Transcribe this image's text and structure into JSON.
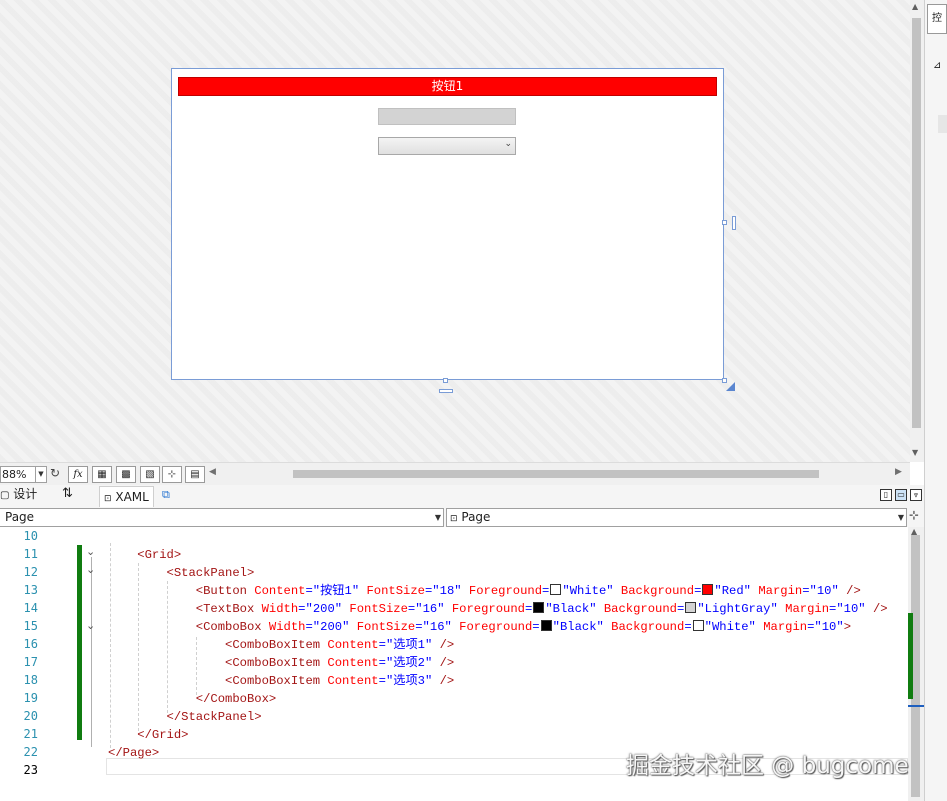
{
  "designer": {
    "preview_button_label": "按钮1",
    "colors": {
      "button_bg": "#ff0000",
      "button_fg": "#ffffff",
      "textbox_bg": "#d3d3d3",
      "frame_border": "#7a9cd6"
    }
  },
  "zoom_toolbar": {
    "zoom_value": "88%",
    "buttons": [
      "fx-icon",
      "grid-icon",
      "snap-grid-icon",
      "artboard-icon",
      "snap-lines-icon",
      "annotations-icon"
    ]
  },
  "tabs": {
    "design_label": "设计",
    "xaml_label": "XAML"
  },
  "nav": {
    "left_selection": "Page",
    "right_selection": "Page"
  },
  "editor": {
    "line_numbers": [
      "10",
      "11",
      "12",
      "13",
      "14",
      "15",
      "16",
      "17",
      "18",
      "19",
      "20",
      "21",
      "22",
      "23"
    ],
    "current_line": "23",
    "lines": [
      {
        "indent": "",
        "tokens": []
      },
      {
        "indent": "    ",
        "tokens": [
          {
            "t": "<Grid>",
            "c": "b"
          }
        ]
      },
      {
        "indent": "        ",
        "tokens": [
          {
            "t": "<StackPanel>",
            "c": "b"
          }
        ]
      },
      {
        "indent": "            ",
        "tokens": [
          {
            "t": "<Button",
            "c": "b"
          },
          {
            "t": " Content",
            "c": "a"
          },
          {
            "t": "=\"",
            "c": "p"
          },
          {
            "t": "按钮1",
            "c": "v"
          },
          {
            "t": "\"",
            "c": "p"
          },
          {
            "t": " FontSize",
            "c": "a"
          },
          {
            "t": "=\"",
            "c": "p"
          },
          {
            "t": "18",
            "c": "v"
          },
          {
            "t": "\"",
            "c": "p"
          },
          {
            "t": " Foreground",
            "c": "a"
          },
          {
            "t": "=",
            "c": "p"
          },
          {
            "sw": "#ffffff"
          },
          {
            "t": "\"",
            "c": "p"
          },
          {
            "t": "White",
            "c": "v"
          },
          {
            "t": "\"",
            "c": "p"
          },
          {
            "t": " Background",
            "c": "a"
          },
          {
            "t": "=",
            "c": "p"
          },
          {
            "sw": "#ff0000"
          },
          {
            "t": "\"",
            "c": "p"
          },
          {
            "t": "Red",
            "c": "v"
          },
          {
            "t": "\"",
            "c": "p"
          },
          {
            "t": " Margin",
            "c": "a"
          },
          {
            "t": "=\"",
            "c": "p"
          },
          {
            "t": "10",
            "c": "v"
          },
          {
            "t": "\"",
            "c": "p"
          },
          {
            "t": " />",
            "c": "b"
          }
        ]
      },
      {
        "indent": "            ",
        "tokens": [
          {
            "t": "<TextBox",
            "c": "b"
          },
          {
            "t": " Width",
            "c": "a"
          },
          {
            "t": "=\"",
            "c": "p"
          },
          {
            "t": "200",
            "c": "v"
          },
          {
            "t": "\"",
            "c": "p"
          },
          {
            "t": " FontSize",
            "c": "a"
          },
          {
            "t": "=\"",
            "c": "p"
          },
          {
            "t": "16",
            "c": "v"
          },
          {
            "t": "\"",
            "c": "p"
          },
          {
            "t": " Foreground",
            "c": "a"
          },
          {
            "t": "=",
            "c": "p"
          },
          {
            "sw": "#000000"
          },
          {
            "t": "\"",
            "c": "p"
          },
          {
            "t": "Black",
            "c": "v"
          },
          {
            "t": "\"",
            "c": "p"
          },
          {
            "t": " Background",
            "c": "a"
          },
          {
            "t": "=",
            "c": "p"
          },
          {
            "sw": "#d3d3d3"
          },
          {
            "t": "\"",
            "c": "p"
          },
          {
            "t": "LightGray",
            "c": "v"
          },
          {
            "t": "\"",
            "c": "p"
          },
          {
            "t": " Margin",
            "c": "a"
          },
          {
            "t": "=\"",
            "c": "p"
          },
          {
            "t": "10",
            "c": "v"
          },
          {
            "t": "\"",
            "c": "p"
          },
          {
            "t": " />",
            "c": "b"
          }
        ]
      },
      {
        "indent": "            ",
        "tokens": [
          {
            "t": "<ComboBox",
            "c": "b"
          },
          {
            "t": " Width",
            "c": "a"
          },
          {
            "t": "=\"",
            "c": "p"
          },
          {
            "t": "200",
            "c": "v"
          },
          {
            "t": "\"",
            "c": "p"
          },
          {
            "t": " FontSize",
            "c": "a"
          },
          {
            "t": "=\"",
            "c": "p"
          },
          {
            "t": "16",
            "c": "v"
          },
          {
            "t": "\"",
            "c": "p"
          },
          {
            "t": " Foreground",
            "c": "a"
          },
          {
            "t": "=",
            "c": "p"
          },
          {
            "sw": "#000000"
          },
          {
            "t": "\"",
            "c": "p"
          },
          {
            "t": "Black",
            "c": "v"
          },
          {
            "t": "\"",
            "c": "p"
          },
          {
            "t": " Background",
            "c": "a"
          },
          {
            "t": "=",
            "c": "p"
          },
          {
            "sw": "#ffffff"
          },
          {
            "t": "\"",
            "c": "p"
          },
          {
            "t": "White",
            "c": "v"
          },
          {
            "t": "\"",
            "c": "p"
          },
          {
            "t": " Margin",
            "c": "a"
          },
          {
            "t": "=\"",
            "c": "p"
          },
          {
            "t": "10",
            "c": "v"
          },
          {
            "t": "\"",
            "c": "p"
          },
          {
            "t": ">",
            "c": "b"
          }
        ]
      },
      {
        "indent": "                ",
        "tokens": [
          {
            "t": "<ComboBoxItem",
            "c": "b"
          },
          {
            "t": " Content",
            "c": "a"
          },
          {
            "t": "=\"",
            "c": "p"
          },
          {
            "t": "选项1",
            "c": "v"
          },
          {
            "t": "\"",
            "c": "p"
          },
          {
            "t": " />",
            "c": "b"
          }
        ]
      },
      {
        "indent": "                ",
        "tokens": [
          {
            "t": "<ComboBoxItem",
            "c": "b"
          },
          {
            "t": " Content",
            "c": "a"
          },
          {
            "t": "=\"",
            "c": "p"
          },
          {
            "t": "选项2",
            "c": "v"
          },
          {
            "t": "\"",
            "c": "p"
          },
          {
            "t": " />",
            "c": "b"
          }
        ]
      },
      {
        "indent": "                ",
        "tokens": [
          {
            "t": "<ComboBoxItem",
            "c": "b"
          },
          {
            "t": " Content",
            "c": "a"
          },
          {
            "t": "=\"",
            "c": "p"
          },
          {
            "t": "选项3",
            "c": "v"
          },
          {
            "t": "\"",
            "c": "p"
          },
          {
            "t": " />",
            "c": "b"
          }
        ]
      },
      {
        "indent": "            ",
        "tokens": [
          {
            "t": "</ComboBox>",
            "c": "b"
          }
        ]
      },
      {
        "indent": "        ",
        "tokens": [
          {
            "t": "</StackPanel>",
            "c": "b"
          }
        ]
      },
      {
        "indent": "    ",
        "tokens": [
          {
            "t": "</Grid>",
            "c": "b"
          }
        ]
      },
      {
        "indent": "",
        "tokens": [
          {
            "t": "</Page>",
            "c": "b"
          }
        ]
      },
      {
        "indent": "",
        "tokens": []
      }
    ]
  },
  "watermark": "掘金技术社区 @ bugcome",
  "right_strip_tab": "控"
}
